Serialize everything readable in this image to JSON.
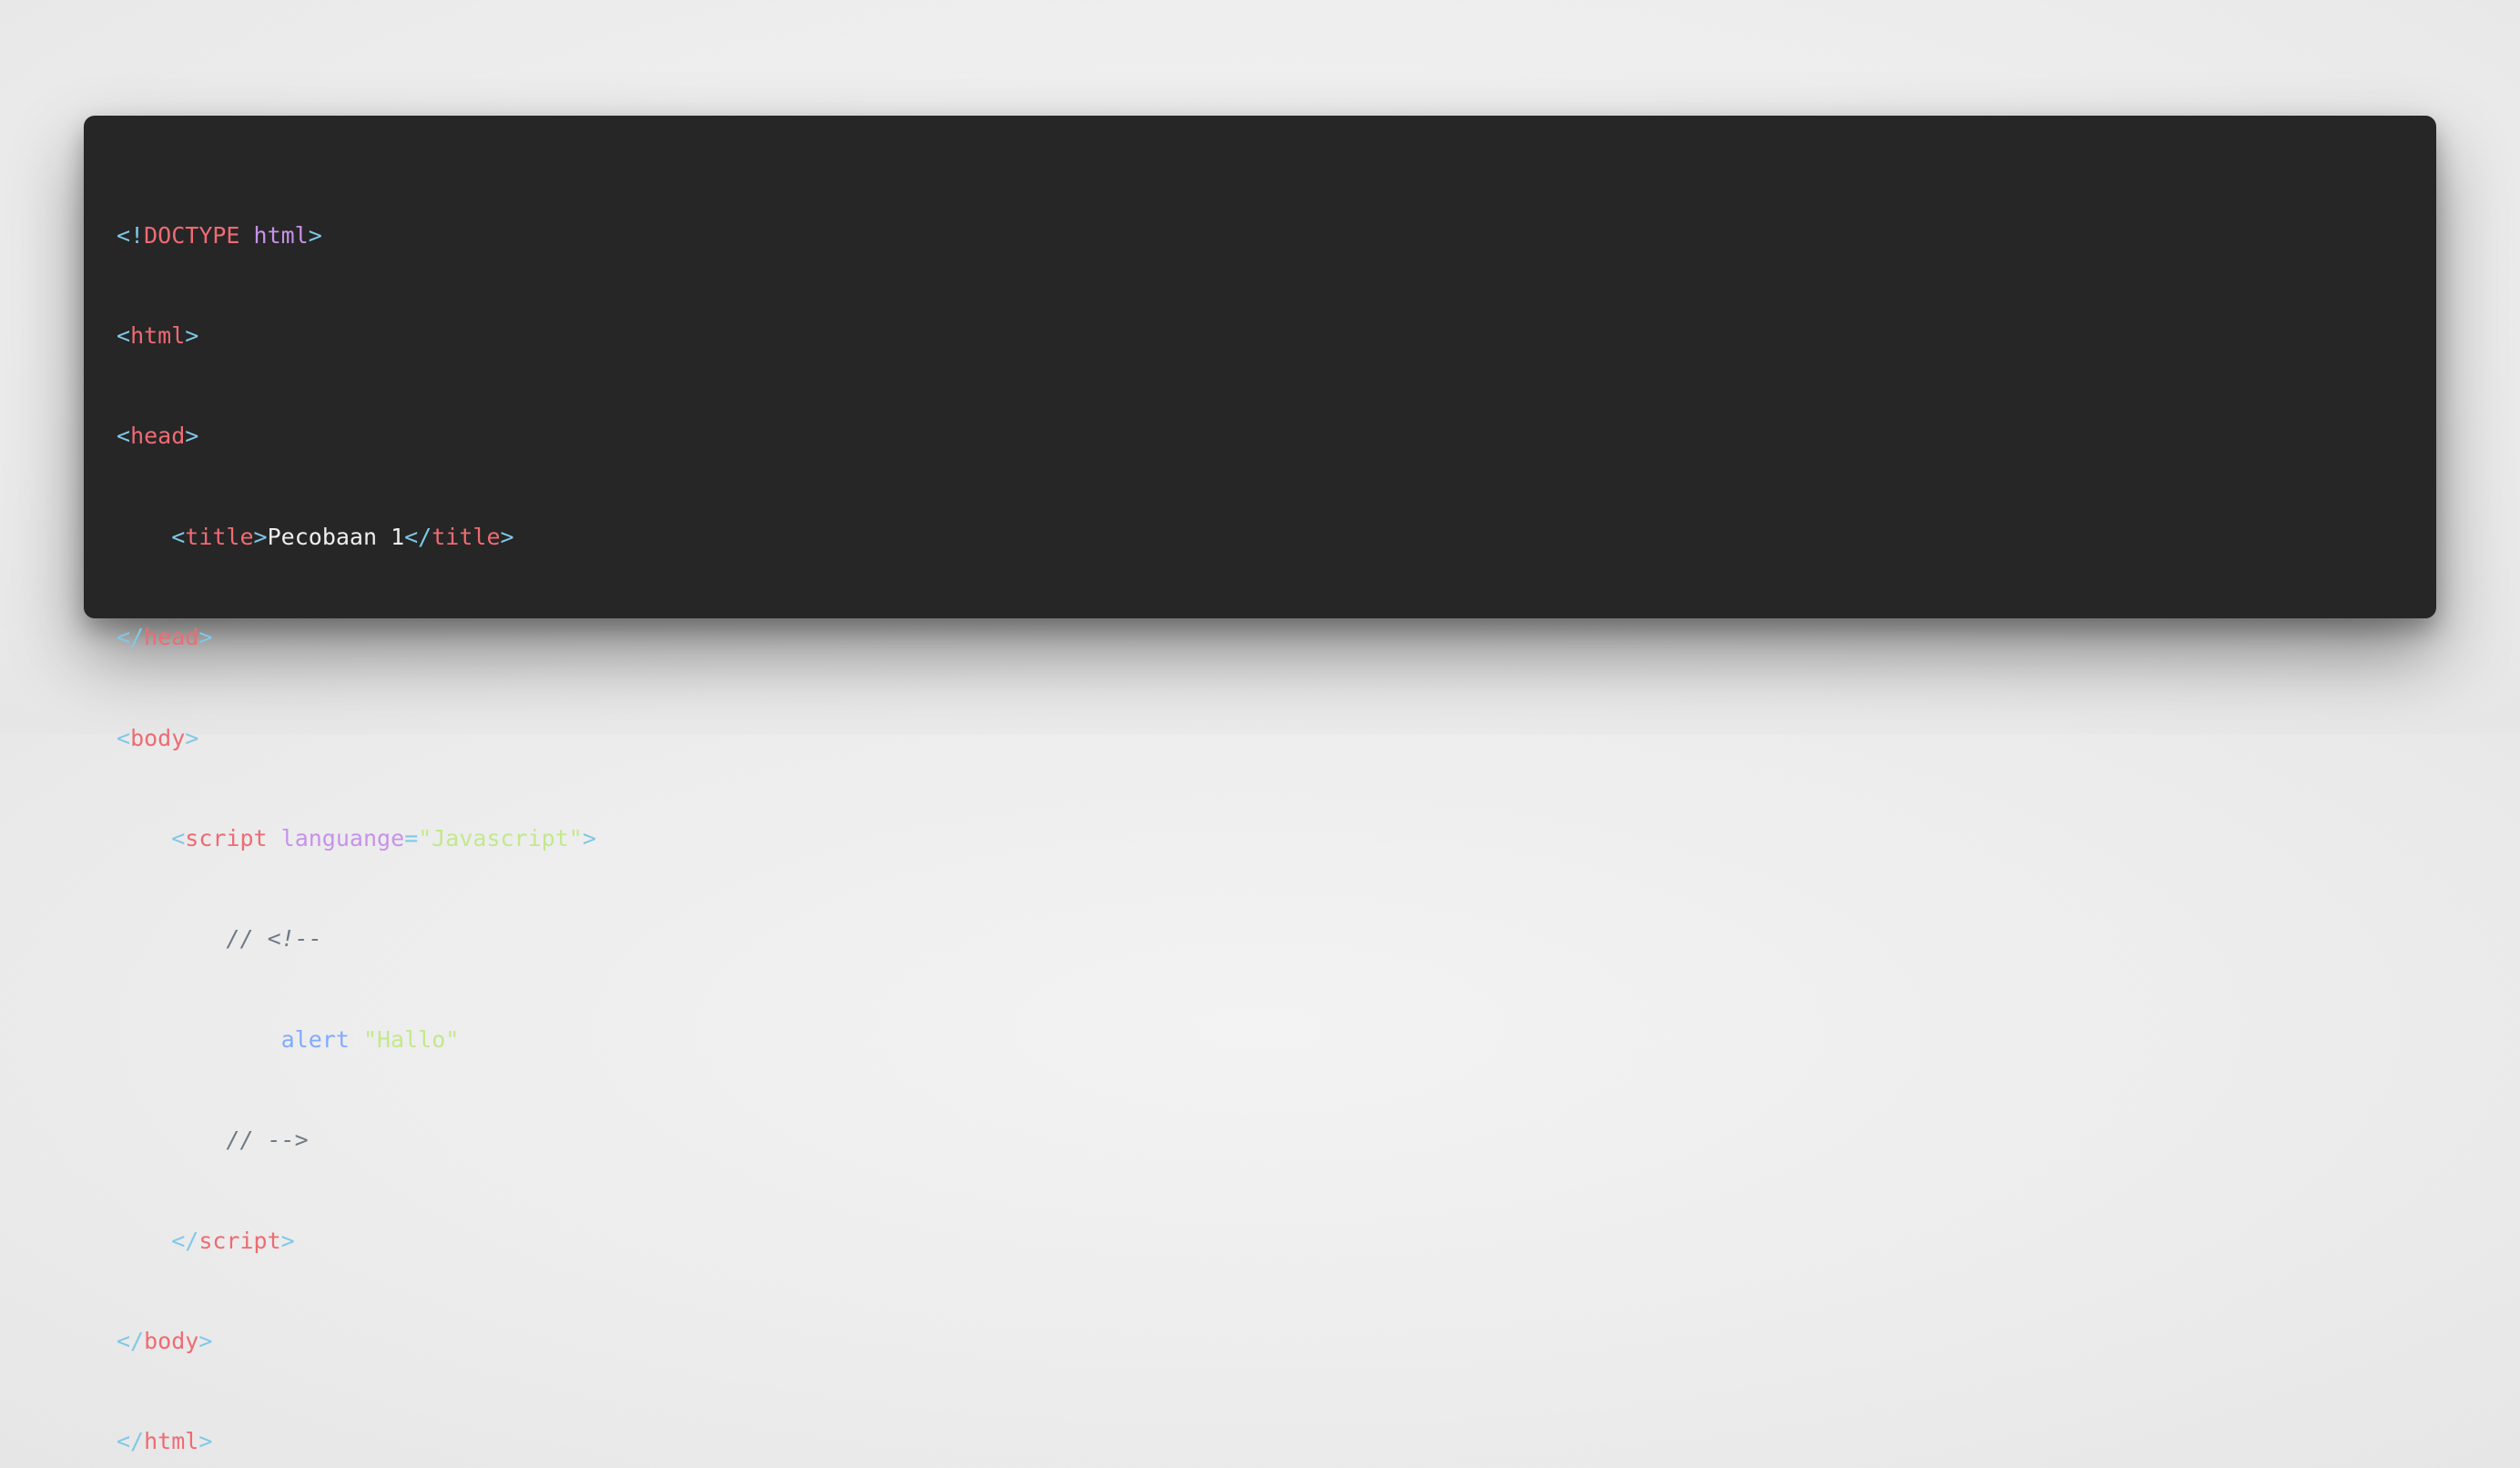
{
  "code": {
    "line1": {
      "p1": "<!",
      "doctype": "DOCTYPE",
      "sp": " ",
      "html": "html",
      "p2": ">"
    },
    "line2": {
      "p1": "<",
      "tag": "html",
      "p2": ">"
    },
    "line3": {
      "p1": "<",
      "tag": "head",
      "p2": ">"
    },
    "line4": {
      "indent": "    ",
      "p1": "<",
      "tag": "title",
      "p2": ">",
      "text": "Pecobaan 1",
      "p3": "</",
      "tag2": "title",
      "p4": ">"
    },
    "line5": {
      "p1": "</",
      "tag": "head",
      "p2": ">"
    },
    "line6": {
      "p1": "<",
      "tag": "body",
      "p2": ">"
    },
    "line7": {
      "indent": "    ",
      "p1": "<",
      "tag": "script",
      "sp": " ",
      "attr": "languange",
      "eq": "=",
      "value": "\"Javascript\"",
      "p2": ">"
    },
    "line8": {
      "indent": "        ",
      "comment": "// <!--"
    },
    "line9": {
      "indent": "            ",
      "fn": "alert",
      "open": "(",
      "str": "\"Hallo\"",
      "close": ");"
    },
    "line10": {
      "indent": "        ",
      "comment": "// -->"
    },
    "line11": {
      "indent": "    ",
      "p1": "</",
      "tag": "script",
      "p2": ">"
    },
    "line12": {
      "p1": "</",
      "tag": "body",
      "p2": ">"
    },
    "line13": {
      "p1": "</",
      "tag": "html",
      "p2": ">"
    }
  },
  "colors": {
    "background": "#262626",
    "punctuation": "#7fc8e8",
    "tag": "#ef6b73",
    "keyword": "#c792ea",
    "string": "#c3e88d",
    "function": "#82aaff",
    "comment": "#6f7a86",
    "text": "#eeeeee"
  }
}
